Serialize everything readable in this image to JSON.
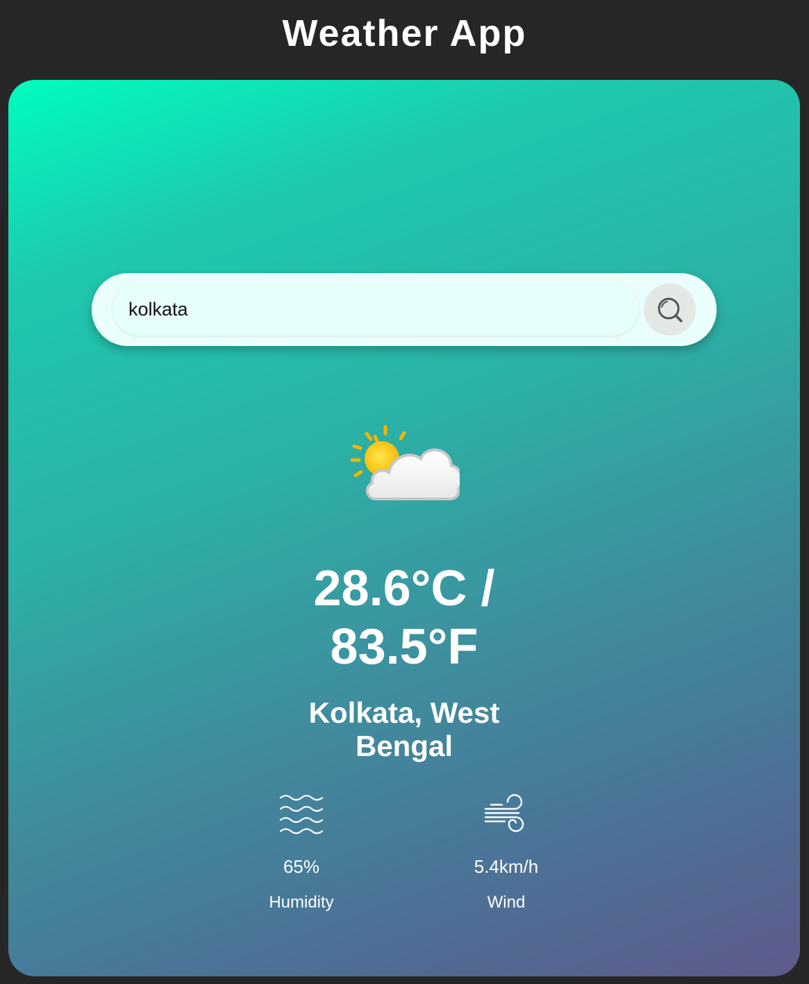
{
  "header": {
    "title": "Weather App"
  },
  "search": {
    "value": "kolkata",
    "icon": "search-icon"
  },
  "weather": {
    "icon": "partly-cloudy-icon",
    "temperature_line1": "28.6°C /",
    "temperature_line2": "83.5°F",
    "location_line1": "Kolkata, West",
    "location_line2": "Bengal"
  },
  "stats": {
    "humidity": {
      "icon": "humidity-icon",
      "value": "65%",
      "label": "Humidity"
    },
    "wind": {
      "icon": "wind-icon",
      "value": "5.4km/h",
      "label": "Wind"
    }
  },
  "colors": {
    "page_background": "#262626",
    "gradient_start": "#00fcbe",
    "gradient_end": "#5e5a8c",
    "search_background": "#eafffb"
  }
}
